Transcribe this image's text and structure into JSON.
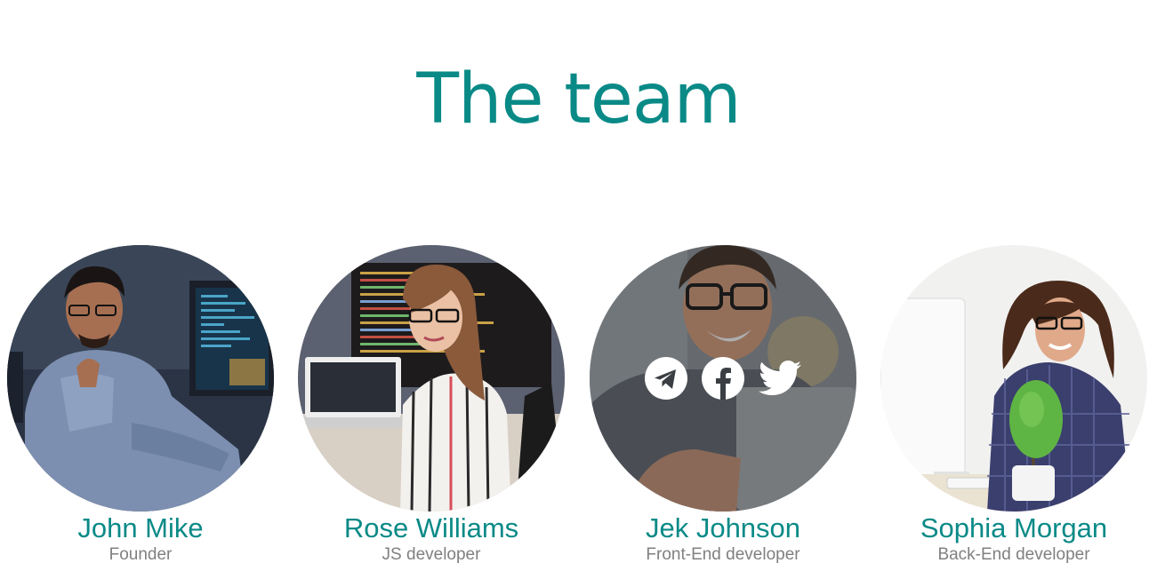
{
  "section": {
    "title": "The team"
  },
  "members": [
    {
      "name": "John Mike",
      "role": "Founder",
      "photo_icon": "person-photo"
    },
    {
      "name": "Rose Williams",
      "role": "JS developer",
      "photo_icon": "person-photo"
    },
    {
      "name": "Jek Johnson",
      "role": "Front-End developer",
      "photo_icon": "person-photo",
      "social_links": [
        "telegram-icon",
        "facebook-icon",
        "twitter-icon"
      ]
    },
    {
      "name": "Sophia Morgan",
      "role": "Back-End developer",
      "photo_icon": "person-photo"
    }
  ],
  "colors": {
    "accent": "#0a8a87",
    "muted": "#808080",
    "background": "#ffffff"
  }
}
